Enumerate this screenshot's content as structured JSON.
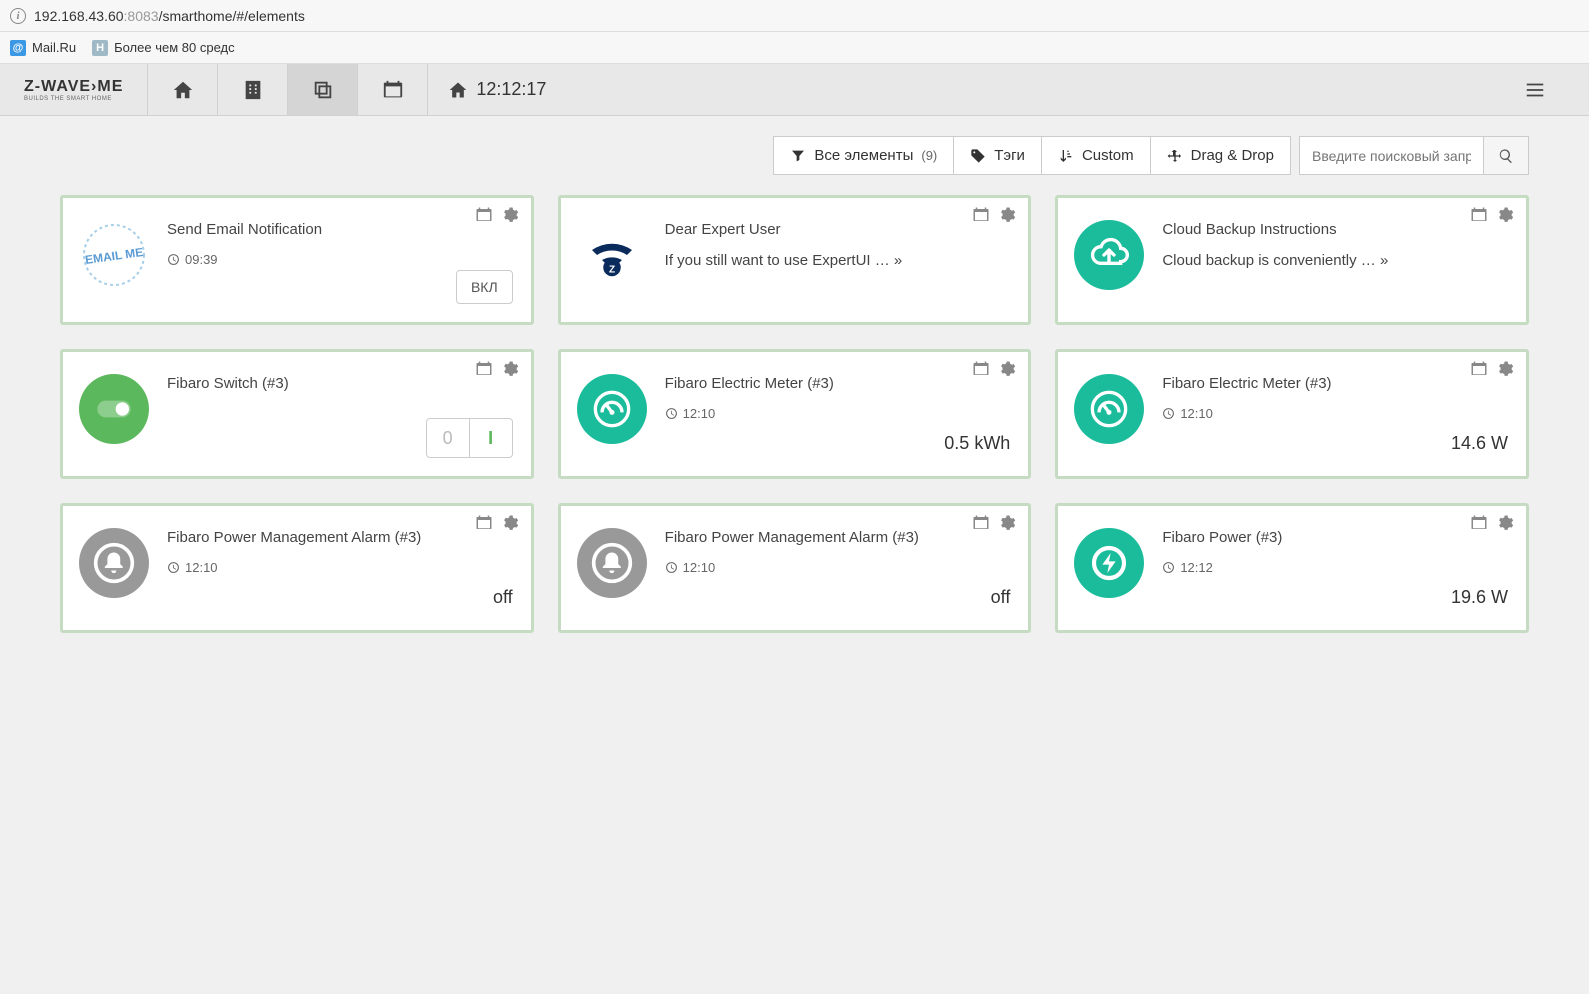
{
  "browser": {
    "url_host": "192.168.43.60",
    "url_port": ":8083",
    "url_path": "/smarthome/#/elements"
  },
  "bookmarks": {
    "mail": "Mail.Ru",
    "habr": "Более чем 80 средс"
  },
  "logo": {
    "main": "Z-WAVE›ME",
    "sub": "BUILDS THE SMART HOME"
  },
  "clock": "12:12:17",
  "filters": {
    "all_label": "Все элементы",
    "all_count": "(9)",
    "tags": "Тэги",
    "custom": "Custom",
    "dragdrop": "Drag & Drop",
    "search_placeholder": "Введите поисковый запрос"
  },
  "cards": [
    {
      "title": "Send Email Notification",
      "time": "09:39",
      "action_btn": "ВКЛ"
    },
    {
      "title": "Dear Expert User",
      "desc": "If you still want to use ExpertUI … »"
    },
    {
      "title": "Cloud Backup Instructions",
      "desc": "Cloud backup is conveniently … »"
    },
    {
      "title": "Fibaro Switch (#3)",
      "switch_off": "0",
      "switch_on": "I"
    },
    {
      "title": "Fibaro Electric Meter (#3)",
      "time": "12:10",
      "value": "0.5 kWh"
    },
    {
      "title": "Fibaro Electric Meter (#3)",
      "time": "12:10",
      "value": "14.6 W"
    },
    {
      "title": "Fibaro Power Management Alarm (#3)",
      "time": "12:10",
      "value": "off"
    },
    {
      "title": "Fibaro Power Management Alarm (#3)",
      "time": "12:10",
      "value": "off"
    },
    {
      "title": "Fibaro Power (#3)",
      "time": "12:12",
      "value": "19.6 W"
    }
  ]
}
